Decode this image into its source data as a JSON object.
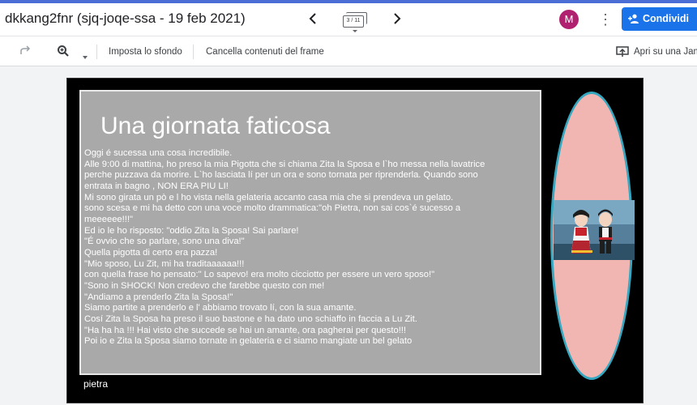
{
  "header": {
    "title": "dkkang2fnr (sjq-joqe-ssa - 19 feb 2021)",
    "frame_counter": "3 / 11",
    "avatar_letter": "M",
    "share_label": "Condividi"
  },
  "toolbar": {
    "set_background_label": "Imposta lo sfondo",
    "clear_frame_label": "Cancella contenuti del frame",
    "open_on_jamboard_label": "Apri su una Jam"
  },
  "slide": {
    "title": "Una giornata faticosa",
    "lines": [
      "Oggi é sucessa una cosa incredibile.",
      "Alle 9:00 di mattina, ho preso la mia Pigotta che si chiama Zita la Sposa e l`ho messa nella lavatrice",
      "perche puzzava da morire. L`ho lasciata lí per un ora e sono tornata per riprenderla. Quando sono",
      "entrata in bagno , NON ERA PIU LI!",
      "Mi sono girata un pò e l ho vista nella gelateria accanto casa mia che si prendeva un gelato.",
      "sono scesa e mi ha detto con una voce molto drammatica:\"oh Pietra, non sai cos`é sucesso a",
      "meeeeee!!!\"",
      "Ed io le ho risposto: \"oddio Zita la Sposa! Sai parlare!",
      "\"É ovvio che so parlare, sono una diva!\"",
      "Quella pigotta di certo era pazza!",
      "\"Mio sposo, Lu Zit, mi ha traditaaaaaa!!!",
      "con quella frase ho pensato:\" Lo sapevo! era molto cicciotto per essere un vero sposo!\"",
      "\"Sono in SHOCK! Non credevo che farebbe questo con me!",
      "\"Andiamo a prenderlo Zita la Sposa!\"",
      "Siamo partite a prenderlo e l' abbiamo trovato lí, con la sua amante.",
      "Cosí Zita la Sposa ha preso il suo bastone e ha dato uno schiaffo in faccia a Lu Zit.",
      "\"Ha ha ha !!! Hai visto che succede se hai un amante, ora pagherai per questo!!!",
      "Poi io e Zita la Sposa siamo tornate in gelateria e ci siamo mangiate un bel gelato"
    ],
    "author": "pietra"
  },
  "colors": {
    "accent": "#1a73e8",
    "avatar": "#b0226f",
    "frame_background": "#000000",
    "textbox_background": "#a9a9a9",
    "oval_fill": "#f2b6b2",
    "oval_border": "#35a7c0"
  }
}
